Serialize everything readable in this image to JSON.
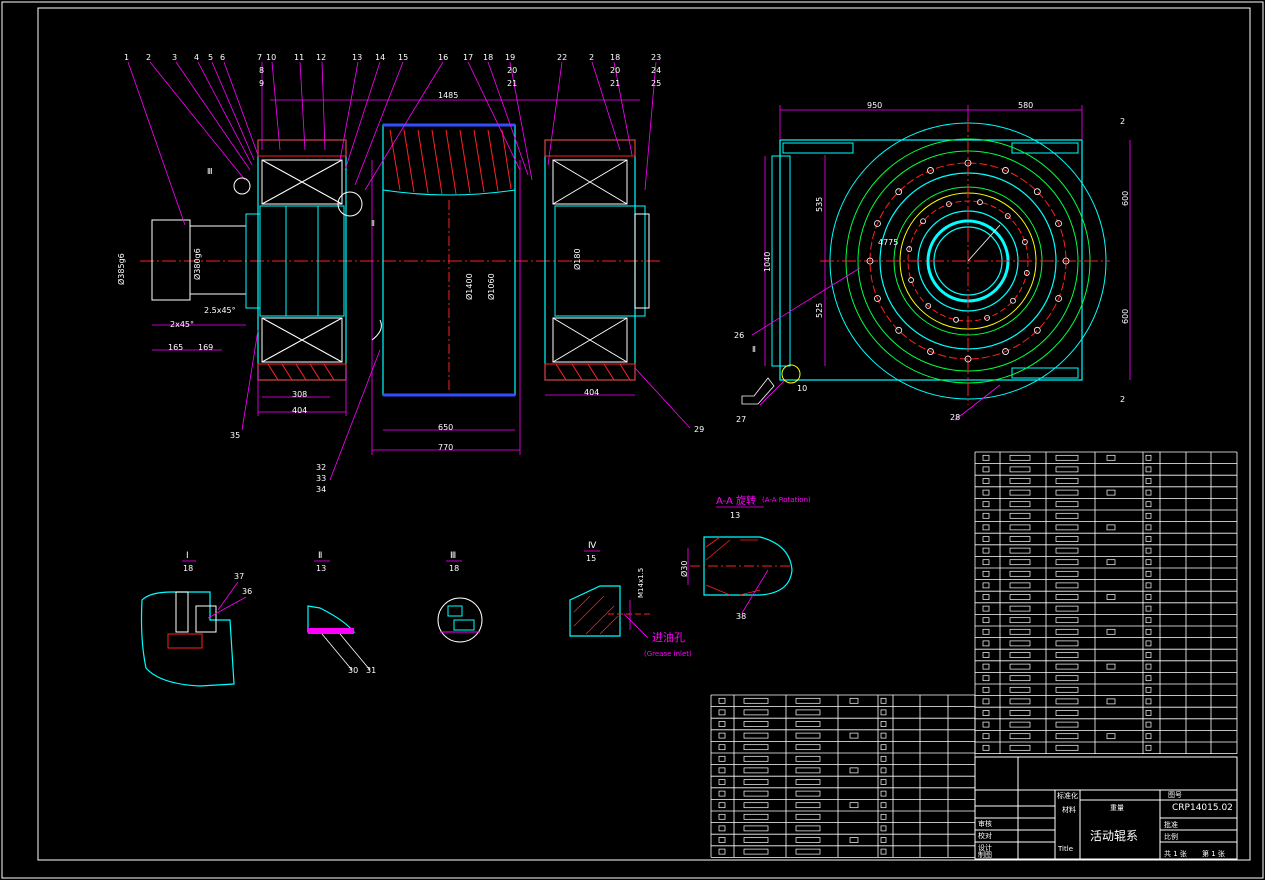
{
  "colors": {
    "background": "#000000",
    "frame": "#ffffff",
    "outline": "#00ffff",
    "center_line": "#ff2020",
    "hatch": "#ff2020",
    "leader": "#ff00ff",
    "dimension": "#ff00ff",
    "text": "#ffffff",
    "grease_text": "#ff00ff",
    "rotation_text": "#ff00ff",
    "circle_green": "#00ff40",
    "circle_yellow": "#ffff00",
    "wheel_blue": "#3050ff"
  },
  "balloons_left": [
    "1",
    "2",
    "3",
    "4",
    "5",
    "6",
    "7",
    "8",
    "9",
    "10",
    "11",
    "12",
    "13",
    "14",
    "15",
    "16"
  ],
  "balloons_right": [
    "17",
    "18",
    "19",
    "20",
    "21",
    "22",
    "2",
    "18",
    "20",
    "21",
    "23",
    "24",
    "25"
  ],
  "dims_front": {
    "overall_length": "1485",
    "shaft_dia_1": "Ø385g6",
    "shaft_dia_2": "Ø380g6",
    "chamfer_1": "2.5x45°",
    "chamfer_2": "2x45°",
    "len_165": "165",
    "len_169": "169",
    "len_308": "308",
    "len_404_left": "404",
    "len_404_right": "404",
    "len_650": "650",
    "len_770": "770",
    "dia_1400": "Ø1400",
    "dia_1060": "Ø1060",
    "dia_180": "Ø180",
    "label_ii": "Ⅱ",
    "label_iii": "Ⅲ"
  },
  "balloons_bottom_left": [
    "35",
    "32",
    "33",
    "34"
  ],
  "balloon_29": "29",
  "dims_side": {
    "width_950": "950",
    "width_580": "580",
    "height_535": "535",
    "height_525": "525",
    "height_1040": "1040",
    "height_600_top": "600",
    "height_600_bottom": "600",
    "small_2_top": "2",
    "small_2_bottom": "2",
    "radius": "4775",
    "balloon_26": "26",
    "balloon_27": "27",
    "balloon_28": "28",
    "dim_10": "10",
    "label_ii": "Ⅱ"
  },
  "section_aa": {
    "title": "A-A 旋转",
    "subtitle": "(A-A Rotation)",
    "scale": "13",
    "dim_dia": "Ø30",
    "balloon": "38"
  },
  "details": [
    {
      "roman": "Ⅰ",
      "scale": "18",
      "balloons": [
        "37",
        "36"
      ]
    },
    {
      "roman": "Ⅱ",
      "scale": "13",
      "balloons": [
        "30",
        "31"
      ]
    },
    {
      "roman": "Ⅲ",
      "scale": "18",
      "balloons": []
    },
    {
      "roman": "Ⅳ",
      "scale": "15",
      "balloons": []
    }
  ],
  "detail_iv": {
    "thread": "M14x1.5",
    "grease_cn": "进油孔",
    "grease_en": "(Grease inlet)"
  },
  "title_block": {
    "drawing_no": "CRP14015.02",
    "name": "活动辊系",
    "scale_label": "比例",
    "title_label": "Title",
    "weight_label": "重量",
    "material_label": "材料",
    "std_label": "标准化",
    "check_label": "审核",
    "proofread_label": "校对",
    "design_label": "设计",
    "draw_label": "制图",
    "sheets_label": "共 1 张",
    "sheet_label": "第 1 张",
    "code_label": "图号",
    "approve_label": "批准"
  }
}
